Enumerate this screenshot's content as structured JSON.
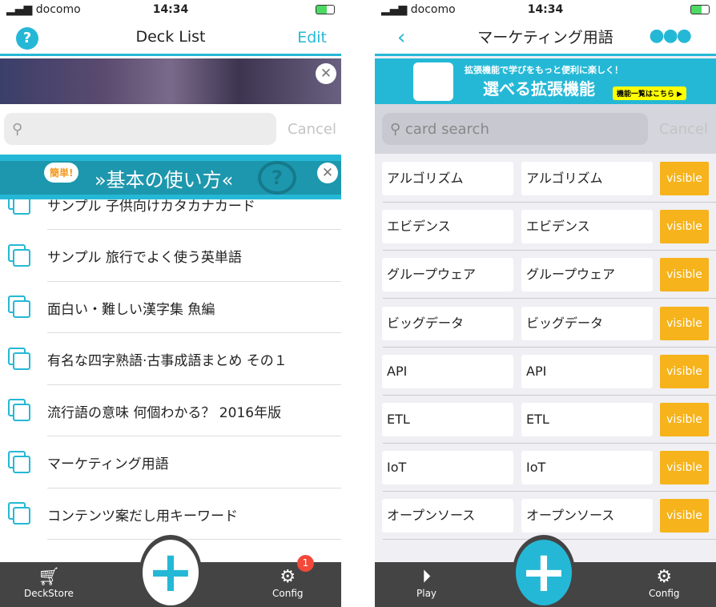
{
  "status": {
    "carrier": "docomo",
    "time": "14:34"
  },
  "colors": {
    "accent": "#25b8d6",
    "visible_button": "#f6b31b",
    "tabbar": "#444444",
    "badge": "#f2493a"
  },
  "left": {
    "nav": {
      "title": "Deck List",
      "edit": "Edit",
      "help": "?"
    },
    "search": {
      "placeholder": "",
      "cancel": "Cancel"
    },
    "howto": {
      "bubble": "簡単!",
      "label": "»基本の使い方«",
      "q": "?"
    },
    "decks": [
      "サンプル 子供向けカタカナカード",
      "サンプル 旅行でよく使う英単語",
      "面白い・難しい漢字集 魚編",
      "有名な四字熟語·古事成語まとめ その１",
      "流行語の意味 何個わかる？ 2016年版",
      "マーケティング用語",
      "コンテンツ案だし用キーワード"
    ],
    "tabs": {
      "store": "DeckStore",
      "config": "Config",
      "badge": "1"
    }
  },
  "right": {
    "nav": {
      "title": "マーケティング用語"
    },
    "ext": {
      "sub": "拡張機能で学びをもっと便利に楽しく！",
      "main": "選べる拡張機能",
      "button": "機能一覧はこちら"
    },
    "search": {
      "placeholder": "card search",
      "cancel": "Cancel"
    },
    "cards": [
      [
        "アルゴリズム",
        "アルゴリズム"
      ],
      [
        "エビデンス",
        "エビデンス"
      ],
      [
        "グループウェア",
        "グループウェア"
      ],
      [
        "ビッグデータ",
        "ビッグデータ"
      ],
      [
        "API",
        "API"
      ],
      [
        "ETL",
        "ETL"
      ],
      [
        "IoT",
        "IoT"
      ],
      [
        "オープンソース",
        "オープンソース"
      ]
    ],
    "visible_label": "visible",
    "tabs": {
      "play": "Play",
      "config": "Config"
    }
  }
}
